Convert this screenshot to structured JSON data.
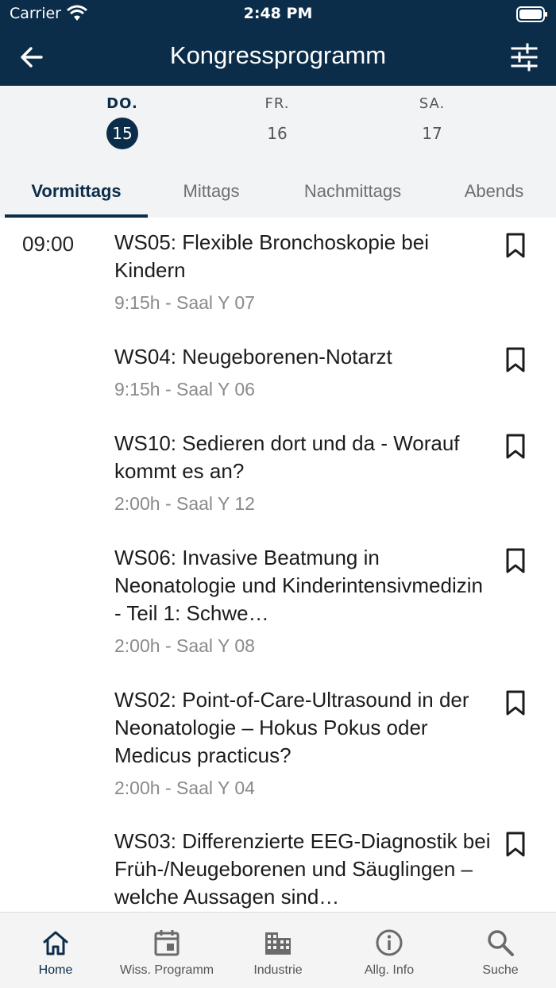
{
  "status_bar": {
    "carrier": "Carrier",
    "time": "2:48 PM"
  },
  "header": {
    "title": "Kongressprogramm",
    "back_icon": "arrow-left-icon",
    "filter_icon": "sliders-icon"
  },
  "days": [
    {
      "dow": "DO.",
      "num": "15",
      "active": true
    },
    {
      "dow": "FR.",
      "num": "16",
      "active": false
    },
    {
      "dow": "SA.",
      "num": "17",
      "active": false
    }
  ],
  "tabs": [
    "Vormittags",
    "Mittags",
    "Nachmittags",
    "Abends"
  ],
  "active_tab": "Vormittags",
  "time_slot": "09:00",
  "sessions": [
    {
      "title": "WS05: Flexible Bronchoskopie bei Kindern",
      "meta": "9:15h - Saal Y 07"
    },
    {
      "title": "WS04: Neugeborenen-Notarzt",
      "meta": "9:15h - Saal Y 06"
    },
    {
      "title": "WS10: Sedieren dort und da - Worauf kommt es an?",
      "meta": "2:00h - Saal Y 12"
    },
    {
      "title": "WS06: Invasive Beatmung in Neonatologie und Kinderintensivmedizin - Teil 1: Schwe…",
      "meta": "2:00h - Saal Y 08"
    },
    {
      "title": "WS02: Point-of-Care-Ultrasound in der Neonatologie – Hokus Pokus oder Medicus practicus?",
      "meta": "2:00h - Saal Y 04"
    },
    {
      "title": "WS03: Differenzierte EEG-Diagnostik bei Früh-/Neugeborenen und Säuglingen – welche Aussagen sind…",
      "meta": ""
    }
  ],
  "bottom_nav": [
    {
      "label": "Home",
      "icon": "home-icon",
      "active": true
    },
    {
      "label": "Wiss. Programm",
      "icon": "calendar-icon",
      "active": false
    },
    {
      "label": "Industrie",
      "icon": "building-icon",
      "active": false
    },
    {
      "label": "Allg. Info",
      "icon": "info-icon",
      "active": false
    },
    {
      "label": "Suche",
      "icon": "search-icon",
      "active": false
    }
  ],
  "colors": {
    "primary": "#0c2d4a",
    "muted": "#8a8a8a"
  }
}
